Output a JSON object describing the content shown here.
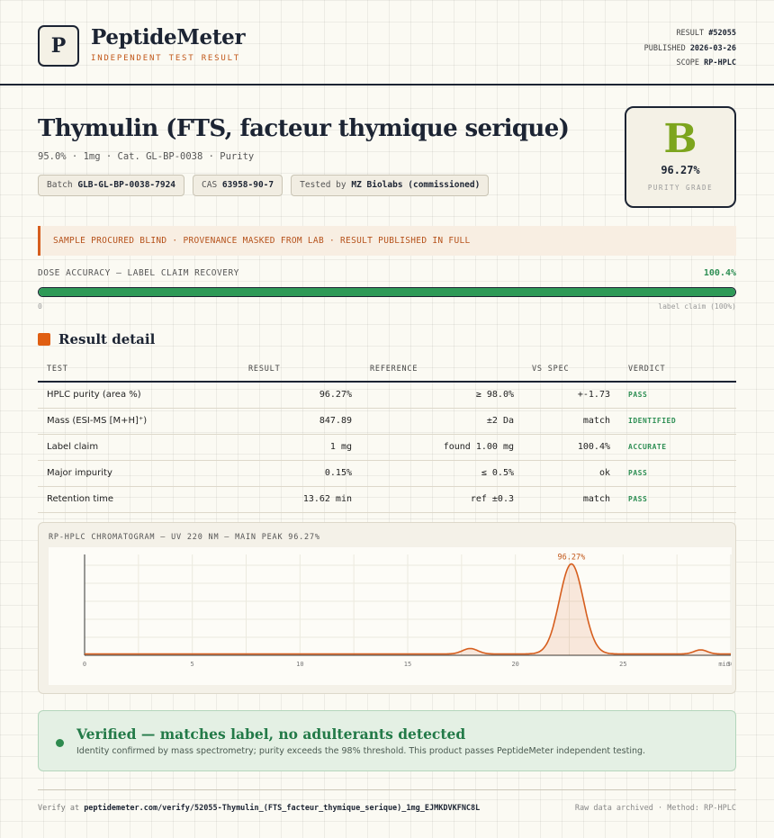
{
  "brand": {
    "logo_letter": "P",
    "name": "PeptideMeter",
    "tagline": "INDEPENDENT TEST RESULT"
  },
  "meta": {
    "result_label": "RESULT",
    "result_value": "#52055",
    "published_label": "PUBLISHED",
    "published_value": "2026-03-26",
    "scope_label": "SCOPE",
    "scope_value": "RP-HPLC"
  },
  "product": {
    "title": "Thymulin (FTS, facteur thymique serique)",
    "subtitle": "95.0% · 1mg · Cat. GL-BP-0038 · Purity",
    "batch_label": "Batch",
    "batch_value": "GLB-GL-BP-0038-7924",
    "cas_label": "CAS",
    "cas_value": "63958-90-7",
    "tested_label": "Tested by",
    "tested_value": "MZ Biolabs (commissioned)"
  },
  "grade": {
    "letter": "B",
    "percent": "96.27%",
    "caption": "PURITY GRADE",
    "color": "#7da51e"
  },
  "banner": "SAMPLE PROCURED BLIND · PROVENANCE MASKED FROM LAB · RESULT PUBLISHED IN FULL",
  "dose": {
    "label": "DOSE ACCURACY — LABEL CLAIM RECOVERY",
    "value_text": "100.4%",
    "fill_fraction": 1.0,
    "min_label": "0",
    "max_label": "label claim (100%)"
  },
  "section_title": "Result detail",
  "table": {
    "headers": [
      "TEST",
      "RESULT",
      "REFERENCE",
      "VS SPEC",
      "VERDICT"
    ],
    "rows": [
      {
        "test": "HPLC purity (area %)",
        "result": "96.27%",
        "reference": "≥ 98.0%",
        "vs_spec": "+-1.73",
        "verdict": "PASS"
      },
      {
        "test": "Mass (ESI-MS [M+H]⁺)",
        "result": "847.89",
        "reference": "±2 Da",
        "vs_spec": "match",
        "verdict": "IDENTIFIED"
      },
      {
        "test": "Label claim",
        "result": "1 mg",
        "reference": "found 1.00 mg",
        "vs_spec": "100.4%",
        "verdict": "ACCURATE"
      },
      {
        "test": "Major impurity",
        "result": "0.15%",
        "reference": "≤ 0.5%",
        "vs_spec": "ok",
        "verdict": "PASS"
      },
      {
        "test": "Retention time",
        "result": "13.62 min",
        "reference": "ref ±0.3",
        "vs_spec": "match",
        "verdict": "PASS"
      }
    ]
  },
  "chromatogram": {
    "caption": "RP-HPLC CHROMATOGRAM — UV 220 NM — MAIN PEAK 96.27%",
    "peak_label": "96.27%",
    "line_color": "#d65e1e"
  },
  "chart_data": {
    "type": "line",
    "title": "RP-HPLC CHROMATOGRAM — UV 220 NM — MAIN PEAK 96.27%",
    "xlabel": "min",
    "ylabel": "",
    "xlim": [
      0,
      30
    ],
    "x_ticks": [
      "0",
      "5",
      "10",
      "15",
      "20",
      "25",
      "30"
    ],
    "grid": true,
    "legend": "none",
    "peaks": [
      {
        "center": 17.9,
        "height": 0.06,
        "width": 0.35
      },
      {
        "center": 22.6,
        "height": 1.0,
        "width": 0.55,
        "label": "96.27%"
      },
      {
        "center": 28.6,
        "height": 0.045,
        "width": 0.3
      }
    ],
    "baseline": 0.015
  },
  "verified": {
    "title": "Verified — matches label, no adulterants detected",
    "description": "Identity confirmed by mass spectrometry; purity exceeds the 98% threshold. This product passes PeptideMeter independent testing."
  },
  "footer": {
    "verify_prefix": "Verify at",
    "verify_url": "peptidemeter.com/verify/52055-Thymulin_(FTS_facteur_thymique_serique)_1mg_EJMKDVKFNC8L",
    "right_text": "Raw data archived · Method: RP-HPLC"
  }
}
